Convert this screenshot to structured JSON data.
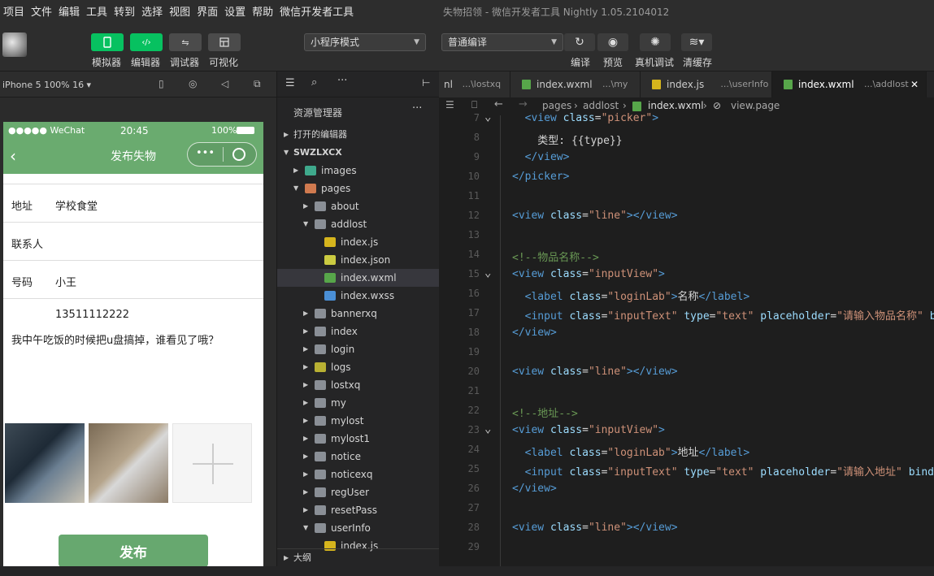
{
  "menu": [
    "项目",
    "文件",
    "编辑",
    "工具",
    "转到",
    "选择",
    "视图",
    "界面",
    "设置",
    "帮助",
    "微信开发者工具"
  ],
  "window_title": "失物招领 - 微信开发者工具 Nightly 1.05.2104012",
  "toolbar": {
    "simulator": "模拟器",
    "editor": "编辑器",
    "debugger": "调试器",
    "visual": "可视化",
    "mode": "小程序模式",
    "compile": "普通编译",
    "compile_btn": "编译",
    "preview": "预览",
    "device_debug": "真机调试",
    "clear_cache": "清缓存"
  },
  "simulator": {
    "device": "iPhone 5 100% 16 ▾",
    "status_left": "●●●●● WeChat",
    "time": "20:45",
    "battery": "100%",
    "title": "发布失物",
    "address_label": "地址",
    "address_value": "学校食堂",
    "contact_label": "联系人",
    "phone_label": "号码",
    "phone_value": "小王",
    "number": "13511112222",
    "description": "我中午吃饭的时候把u盘搞掉，谁看见了哦？",
    "publish": "发布"
  },
  "explorer": {
    "title": "资源管理器",
    "open_editors": "打开的编辑器",
    "project": "SWZLXCX",
    "outline": "大纲",
    "items": [
      {
        "name": "images",
        "kind": "folder-img",
        "depth": 1,
        "open": false
      },
      {
        "name": "pages",
        "kind": "folder-pages",
        "depth": 1,
        "open": true
      },
      {
        "name": "about",
        "kind": "folder",
        "depth": 2,
        "open": false
      },
      {
        "name": "addlost",
        "kind": "folder",
        "depth": 2,
        "open": true
      },
      {
        "name": "index.js",
        "kind": "js",
        "depth": 3
      },
      {
        "name": "index.json",
        "kind": "json",
        "depth": 3
      },
      {
        "name": "index.wxml",
        "kind": "wxml",
        "depth": 3,
        "selected": true
      },
      {
        "name": "index.wxss",
        "kind": "wxss",
        "depth": 3
      },
      {
        "name": "bannerxq",
        "kind": "folder",
        "depth": 2,
        "open": false
      },
      {
        "name": "index",
        "kind": "folder",
        "depth": 2,
        "open": false
      },
      {
        "name": "login",
        "kind": "folder",
        "depth": 2,
        "open": false
      },
      {
        "name": "logs",
        "kind": "folder-logs",
        "depth": 2,
        "open": false
      },
      {
        "name": "lostxq",
        "kind": "folder",
        "depth": 2,
        "open": false
      },
      {
        "name": "my",
        "kind": "folder",
        "depth": 2,
        "open": false
      },
      {
        "name": "mylost",
        "kind": "folder",
        "depth": 2,
        "open": false
      },
      {
        "name": "mylost1",
        "kind": "folder",
        "depth": 2,
        "open": false
      },
      {
        "name": "notice",
        "kind": "folder",
        "depth": 2,
        "open": false
      },
      {
        "name": "noticexq",
        "kind": "folder",
        "depth": 2,
        "open": false
      },
      {
        "name": "regUser",
        "kind": "folder",
        "depth": 2,
        "open": false
      },
      {
        "name": "resetPass",
        "kind": "folder",
        "depth": 2,
        "open": false
      },
      {
        "name": "userInfo",
        "kind": "folder",
        "depth": 2,
        "open": true
      },
      {
        "name": "index.js",
        "kind": "js",
        "depth": 3
      }
    ]
  },
  "tabs": [
    {
      "name": "nl",
      "path": "...\\lostxq",
      "kind": "none"
    },
    {
      "name": "index.wxml",
      "path": "...\\my",
      "kind": "wxml"
    },
    {
      "name": "index.js",
      "path": "...\\userInfo",
      "kind": "js"
    },
    {
      "name": "index.wxml",
      "path": "...\\addlost",
      "kind": "wxml",
      "active": true
    }
  ],
  "breadcrumb": [
    "pages",
    "addlost",
    "index.wxml",
    "view.page"
  ],
  "code": [
    {
      "n": "7",
      "fold": true,
      "html": "  <span class='t'>&lt;view</span> <span class='a'>class</span>=<span class='s'>\"picker\"</span><span class='t'>&gt;</span>"
    },
    {
      "n": "8",
      "html": "    类型: {{type}}"
    },
    {
      "n": "9",
      "html": "  <span class='t'>&lt;/view&gt;</span>"
    },
    {
      "n": "10",
      "html": "<span class='t'>&lt;/picker&gt;</span>"
    },
    {
      "n": "11",
      "html": ""
    },
    {
      "n": "12",
      "html": "<span class='t'>&lt;view</span> <span class='a'>class</span>=<span class='s'>\"line\"</span><span class='t'>&gt;&lt;/view&gt;</span>"
    },
    {
      "n": "13",
      "html": ""
    },
    {
      "n": "14",
      "html": "<span class='c'>&lt;!--物品名称--&gt;</span>"
    },
    {
      "n": "15",
      "fold": true,
      "html": "<span class='t'>&lt;view</span> <span class='a'>class</span>=<span class='s'>\"inputView\"</span><span class='t'>&gt;</span>"
    },
    {
      "n": "16",
      "html": "  <span class='t'>&lt;label</span> <span class='a'>class</span>=<span class='s'>\"loginLab\"</span><span class='t'>&gt;</span>名称<span class='t'>&lt;/label&gt;</span>"
    },
    {
      "n": "17",
      "html": "  <span class='t'>&lt;input</span> <span class='a'>class</span>=<span class='s'>\"inputText\"</span> <span class='a'>type</span>=<span class='s'>\"text\"</span> <span class='a'>placeholder</span>=<span class='s'>\"请输入物品名称\"</span> <span class='a'>b</span>"
    },
    {
      "n": "18",
      "html": "<span class='t'>&lt;/view&gt;</span>"
    },
    {
      "n": "19",
      "html": ""
    },
    {
      "n": "20",
      "html": "<span class='t'>&lt;view</span> <span class='a'>class</span>=<span class='s'>\"line\"</span><span class='t'>&gt;&lt;/view&gt;</span>"
    },
    {
      "n": "21",
      "html": ""
    },
    {
      "n": "22",
      "html": "<span class='c'>&lt;!--地址--&gt;</span>"
    },
    {
      "n": "23",
      "fold": true,
      "html": "<span class='t'>&lt;view</span> <span class='a'>class</span>=<span class='s'>\"inputView\"</span><span class='t'>&gt;</span>"
    },
    {
      "n": "24",
      "html": "  <span class='t'>&lt;label</span> <span class='a'>class</span>=<span class='s'>\"loginLab\"</span><span class='t'>&gt;</span>地址<span class='t'>&lt;/label&gt;</span>"
    },
    {
      "n": "25",
      "html": "  <span class='t'>&lt;input</span> <span class='a'>class</span>=<span class='s'>\"inputText\"</span> <span class='a'>type</span>=<span class='s'>\"text\"</span> <span class='a'>placeholder</span>=<span class='s'>\"请输入地址\"</span> <span class='a'>bindi</span>"
    },
    {
      "n": "26",
      "html": "<span class='t'>&lt;/view&gt;</span>"
    },
    {
      "n": "27",
      "html": ""
    },
    {
      "n": "28",
      "html": "<span class='t'>&lt;view</span> <span class='a'>class</span>=<span class='s'>\"line\"</span><span class='t'>&gt;&lt;/view&gt;</span>"
    },
    {
      "n": "29",
      "html": ""
    }
  ],
  "colors": {
    "accent": "#07c160",
    "nav_green": "#6aab6f",
    "publish": "#67a86f"
  }
}
